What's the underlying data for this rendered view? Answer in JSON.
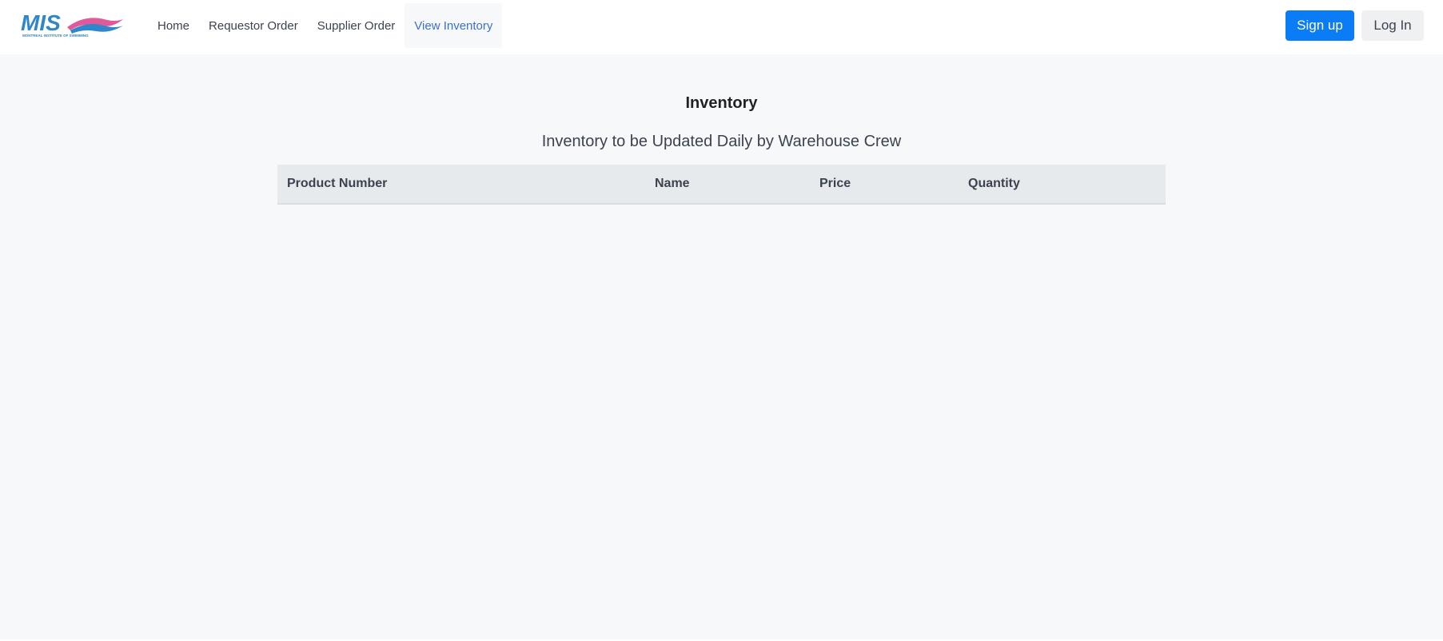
{
  "navbar": {
    "logo_text": "MIS",
    "logo_subtext": "MONTREAL INSTITUTE OF SWIMMING",
    "links": [
      {
        "label": "Home"
      },
      {
        "label": "Requestor Order"
      },
      {
        "label": "Supplier Order"
      },
      {
        "label": "View Inventory",
        "active": true
      }
    ],
    "signup_label": "Sign up",
    "login_label": "Log In"
  },
  "main": {
    "title": "Inventory",
    "subtitle": "Inventory to be Updated Daily by Warehouse Crew",
    "table": {
      "columns": [
        "Product Number",
        "Name",
        "Price",
        "Quantity"
      ],
      "rows": []
    }
  },
  "colors": {
    "accent": "#0a7cf5",
    "active_link": "#3d6fcf",
    "background": "#f7f8fa"
  }
}
